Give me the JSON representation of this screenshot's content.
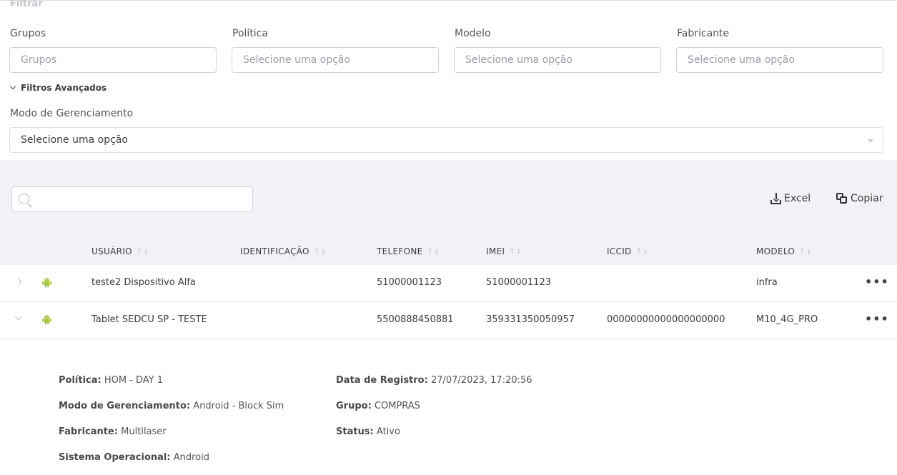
{
  "filters": {
    "title": "Filtrar",
    "fields": [
      {
        "label": "Grupos",
        "placeholder": "Grupos"
      },
      {
        "label": "Política",
        "placeholder": "Selecione uma opção"
      },
      {
        "label": "Modelo",
        "placeholder": "Selecione uma opção"
      },
      {
        "label": "Fabricante",
        "placeholder": "Selecione uma opção"
      }
    ],
    "advanced_label": "Filtros Avançados",
    "management_mode": {
      "label": "Modo de Gerenciamento",
      "value": "Selecione uma opção"
    }
  },
  "toolbar": {
    "search_value": "",
    "excel_label": "Excel",
    "copy_label": "Copiar",
    "icons": [
      "search-icon",
      "download-icon",
      "copy-icon"
    ]
  },
  "table": {
    "columns": [
      "USUÁRIO",
      "IDENTIFICAÇÃO",
      "TELEFONE",
      "IMEI",
      "ICCID",
      "MODELO"
    ],
    "rows": [
      {
        "usuario": "teste2 Dispositivo Alfa",
        "identificacao": "",
        "telefone": "51000001123",
        "imei": "51000001123",
        "iccid": "",
        "modelo": "infra",
        "expanded": false
      },
      {
        "usuario": "Tablet SEDCU SP - TESTE",
        "identificacao": "",
        "telefone": "5500888450881",
        "imei": "359331350050957",
        "iccid": "00000000000000000000",
        "modelo": "M10_4G_PRO",
        "expanded": true
      }
    ]
  },
  "details": {
    "politica_label": "Política:",
    "politica": "HOM - DAY 1",
    "modo_label": "Modo de Gerenciamento:",
    "modo": "Android - Block Sim",
    "fabricante_label": "Fabricante:",
    "fabricante": "Multilaser",
    "so_label": "Sistema Operacional:",
    "so": "Android",
    "registro_label": "Data de Registro:",
    "registro": "27/07/2023, 17:20:56",
    "grupo_label": "Grupo:",
    "grupo": "COMPRAS",
    "status_label": "Status:",
    "status": "Ativo"
  },
  "colors": {
    "android_green": "#a4c639",
    "table_bg": "#f1f2f7"
  }
}
